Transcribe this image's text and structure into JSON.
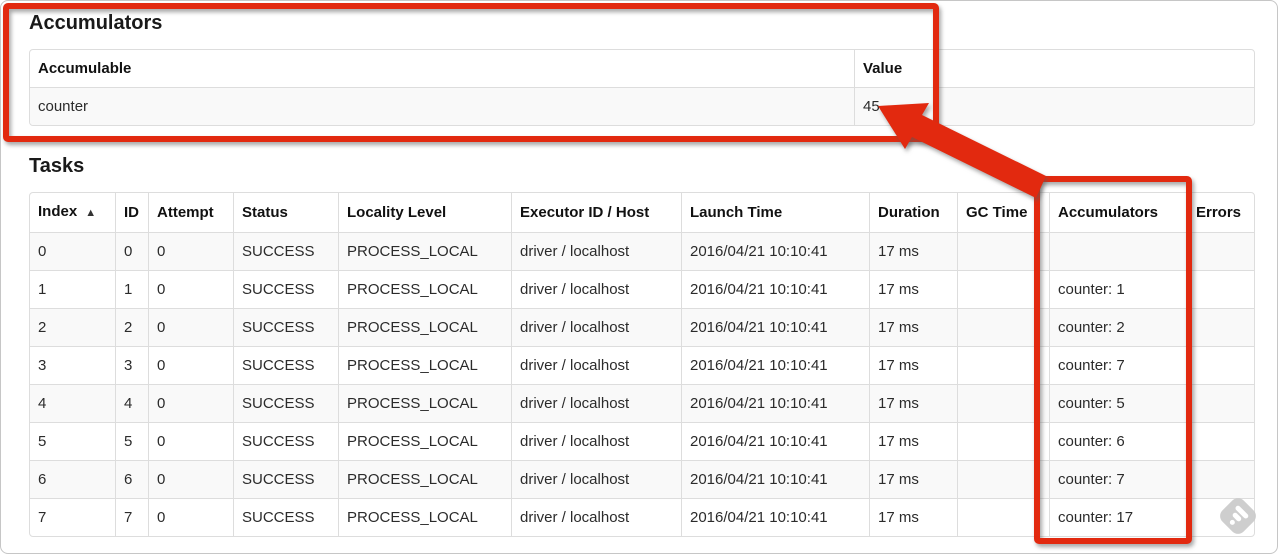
{
  "accumulators_section": {
    "title": "Accumulators",
    "table": {
      "columns": [
        "Accumulable",
        "Value"
      ],
      "rows": [
        [
          "counter",
          "45"
        ]
      ]
    }
  },
  "tasks_section": {
    "title": "Tasks",
    "table": {
      "columns": [
        "Index",
        "ID",
        "Attempt",
        "Status",
        "Locality Level",
        "Executor ID / Host",
        "Launch Time",
        "Duration",
        "GC Time",
        "Accumulators",
        "Errors"
      ],
      "sort_column": "Index",
      "sort_direction_icon": "▲",
      "rows": [
        [
          "0",
          "0",
          "0",
          "SUCCESS",
          "PROCESS_LOCAL",
          "driver / localhost",
          "2016/04/21 10:10:41",
          "17 ms",
          "",
          "",
          ""
        ],
        [
          "1",
          "1",
          "0",
          "SUCCESS",
          "PROCESS_LOCAL",
          "driver / localhost",
          "2016/04/21 10:10:41",
          "17 ms",
          "",
          "counter: 1",
          ""
        ],
        [
          "2",
          "2",
          "0",
          "SUCCESS",
          "PROCESS_LOCAL",
          "driver / localhost",
          "2016/04/21 10:10:41",
          "17 ms",
          "",
          "counter: 2",
          ""
        ],
        [
          "3",
          "3",
          "0",
          "SUCCESS",
          "PROCESS_LOCAL",
          "driver / localhost",
          "2016/04/21 10:10:41",
          "17 ms",
          "",
          "counter: 7",
          ""
        ],
        [
          "4",
          "4",
          "0",
          "SUCCESS",
          "PROCESS_LOCAL",
          "driver / localhost",
          "2016/04/21 10:10:41",
          "17 ms",
          "",
          "counter: 5",
          ""
        ],
        [
          "5",
          "5",
          "0",
          "SUCCESS",
          "PROCESS_LOCAL",
          "driver / localhost",
          "2016/04/21 10:10:41",
          "17 ms",
          "",
          "counter: 6",
          ""
        ],
        [
          "6",
          "6",
          "0",
          "SUCCESS",
          "PROCESS_LOCAL",
          "driver / localhost",
          "2016/04/21 10:10:41",
          "17 ms",
          "",
          "counter: 7",
          ""
        ],
        [
          "7",
          "7",
          "0",
          "SUCCESS",
          "PROCESS_LOCAL",
          "driver / localhost",
          "2016/04/21 10:10:41",
          "17 ms",
          "",
          "counter: 17",
          ""
        ]
      ]
    }
  },
  "annotations": {
    "accent_color": "#e2290f",
    "arrow_points_to_value": "45",
    "highlighted_regions": [
      "accumulators-summary-table",
      "accumulators-task-column"
    ]
  },
  "watermark": {
    "icon": "feedly-icon",
    "color": "#cccccc"
  }
}
